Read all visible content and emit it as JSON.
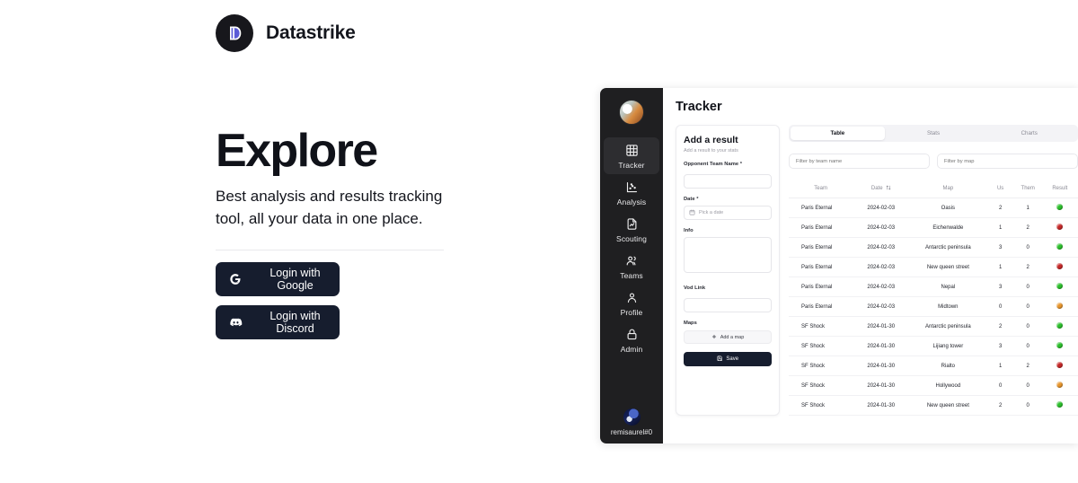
{
  "brand": {
    "name": "Datastrike",
    "logo_icon": "datastrike-d-logo",
    "logo_color": "#5b5bd6"
  },
  "hero": {
    "title": "Explore",
    "subtitle": "Best analysis and results tracking tool, all your data in one place."
  },
  "auth": {
    "buttons": [
      {
        "label": "Login with Google",
        "icon": "google-g-icon"
      },
      {
        "label": "Login with Discord",
        "icon": "discord-icon"
      }
    ]
  },
  "app": {
    "sidebar": {
      "avatar_icon": "team-avatar",
      "items": [
        {
          "label": "Tracker",
          "icon": "table-grid-icon",
          "active": true
        },
        {
          "label": "Analysis",
          "icon": "scatter-chart-icon",
          "active": false
        },
        {
          "label": "Scouting",
          "icon": "document-chart-icon",
          "active": false
        },
        {
          "label": "Teams",
          "icon": "users-icon",
          "active": false
        },
        {
          "label": "Profile",
          "icon": "user-icon",
          "active": false
        },
        {
          "label": "Admin",
          "icon": "lock-icon",
          "active": false
        }
      ],
      "user": {
        "name": "remisaurel#0",
        "avatar_icon": "user-avatar"
      }
    },
    "page_title": "Tracker",
    "form": {
      "title": "Add a result",
      "subtitle": "Add a result to your stats",
      "opponent_label": "Opponent Team Name",
      "opponent_required": "*",
      "opponent_value": "",
      "opponent_placeholder": "",
      "date_label": "Date",
      "date_required": "*",
      "date_placeholder": "Pick a date",
      "date_icon": "calendar-icon",
      "info_label": "Info",
      "info_value": "",
      "vod_label": "Vod Link",
      "vod_value": "",
      "maps_label": "Maps",
      "add_map_label": "Add a map",
      "add_map_icon": "plus-icon",
      "save_label": "Save",
      "save_icon": "save-disk-icon"
    },
    "tabs": [
      {
        "label": "Table",
        "active": true
      },
      {
        "label": "Stats",
        "active": false
      },
      {
        "label": "Charts",
        "active": false
      }
    ],
    "filters": {
      "team_placeholder": "Filter by team name",
      "team_value": "",
      "map_placeholder": "Filter by map",
      "map_value": ""
    },
    "table": {
      "columns": [
        "Team",
        "Date",
        "Map",
        "Us",
        "Them",
        "Result"
      ],
      "sorted_column": "Date",
      "sort_icon": "sort-updown-icon",
      "result_colors": {
        "win": "#2cc02c",
        "loss": "#c62828",
        "draw": "#e8962d"
      },
      "rows": [
        {
          "team": "Paris Eternal",
          "date": "2024-02-03",
          "map": "Oasis",
          "us": "2",
          "them": "1",
          "result": "win"
        },
        {
          "team": "Paris Eternal",
          "date": "2024-02-03",
          "map": "Eichenwalde",
          "us": "1",
          "them": "2",
          "result": "loss"
        },
        {
          "team": "Paris Eternal",
          "date": "2024-02-03",
          "map": "Antarctic peninsula",
          "us": "3",
          "them": "0",
          "result": "win"
        },
        {
          "team": "Paris Eternal",
          "date": "2024-02-03",
          "map": "New queen street",
          "us": "1",
          "them": "2",
          "result": "loss"
        },
        {
          "team": "Paris Eternal",
          "date": "2024-02-03",
          "map": "Nepal",
          "us": "3",
          "them": "0",
          "result": "win"
        },
        {
          "team": "Paris Eternal",
          "date": "2024-02-03",
          "map": "Midtown",
          "us": "0",
          "them": "0",
          "result": "draw"
        },
        {
          "team": "SF Shock",
          "date": "2024-01-30",
          "map": "Antarctic peninsula",
          "us": "2",
          "them": "0",
          "result": "win"
        },
        {
          "team": "SF Shock",
          "date": "2024-01-30",
          "map": "Lijiang tower",
          "us": "3",
          "them": "0",
          "result": "win"
        },
        {
          "team": "SF Shock",
          "date": "2024-01-30",
          "map": "Rialto",
          "us": "1",
          "them": "2",
          "result": "loss"
        },
        {
          "team": "SF Shock",
          "date": "2024-01-30",
          "map": "Hollywood",
          "us": "0",
          "them": "0",
          "result": "draw"
        },
        {
          "team": "SF Shock",
          "date": "2024-01-30",
          "map": "New queen street",
          "us": "2",
          "them": "0",
          "result": "win"
        }
      ]
    }
  }
}
